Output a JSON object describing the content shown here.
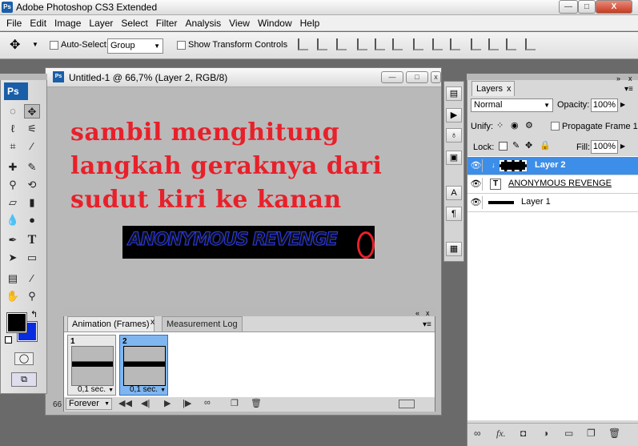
{
  "app": {
    "title": "Adobe Photoshop CS3 Extended",
    "logo": "Ps"
  },
  "window_controls": {
    "minimize": "—",
    "maximize": "□",
    "close": "X"
  },
  "menu": [
    "File",
    "Edit",
    "Image",
    "Layer",
    "Select",
    "Filter",
    "Analysis",
    "View",
    "Window",
    "Help"
  ],
  "options": {
    "auto_select_label": "Auto-Select:",
    "auto_select_value": "Group",
    "show_transform_label": "Show Transform Controls"
  },
  "document": {
    "title": "Untitled-1 @ 66,7% (Layer 2, RGB/8)",
    "overlay_lines": [
      "sambil menghitung",
      "langkah geraknya dari",
      "sudut kiri ke kanan"
    ],
    "banner_text": "ANONYMOUS REVENGE",
    "zoom": "66"
  },
  "toolbox": {
    "badge": "Ps"
  },
  "colors": {
    "foreground": "#000000",
    "background": "#0a2ce0",
    "overlay_text": "#e8202a",
    "selection": "#3d8ee8"
  },
  "animation": {
    "tabs": [
      {
        "label": "Animation (Frames)"
      },
      {
        "label": "Measurement Log"
      }
    ],
    "frames": [
      {
        "number": "1",
        "delay": "0,1 sec."
      },
      {
        "number": "2",
        "delay": "0,1 sec."
      }
    ],
    "loop": "Forever"
  },
  "layers": {
    "tab_label": "Layers",
    "blend_mode": "Normal",
    "opacity_label": "Opacity:",
    "opacity": "100%",
    "unify_label": "Unify:",
    "propagate_label": "Propagate Frame 1",
    "lock_label": "Lock:",
    "fill_label": "Fill:",
    "fill": "100%",
    "rows": [
      {
        "name": "Layer 2"
      },
      {
        "name": "ANONYMOUS REVENGE"
      },
      {
        "name": "Layer 1"
      }
    ],
    "fx_label": "fx."
  }
}
